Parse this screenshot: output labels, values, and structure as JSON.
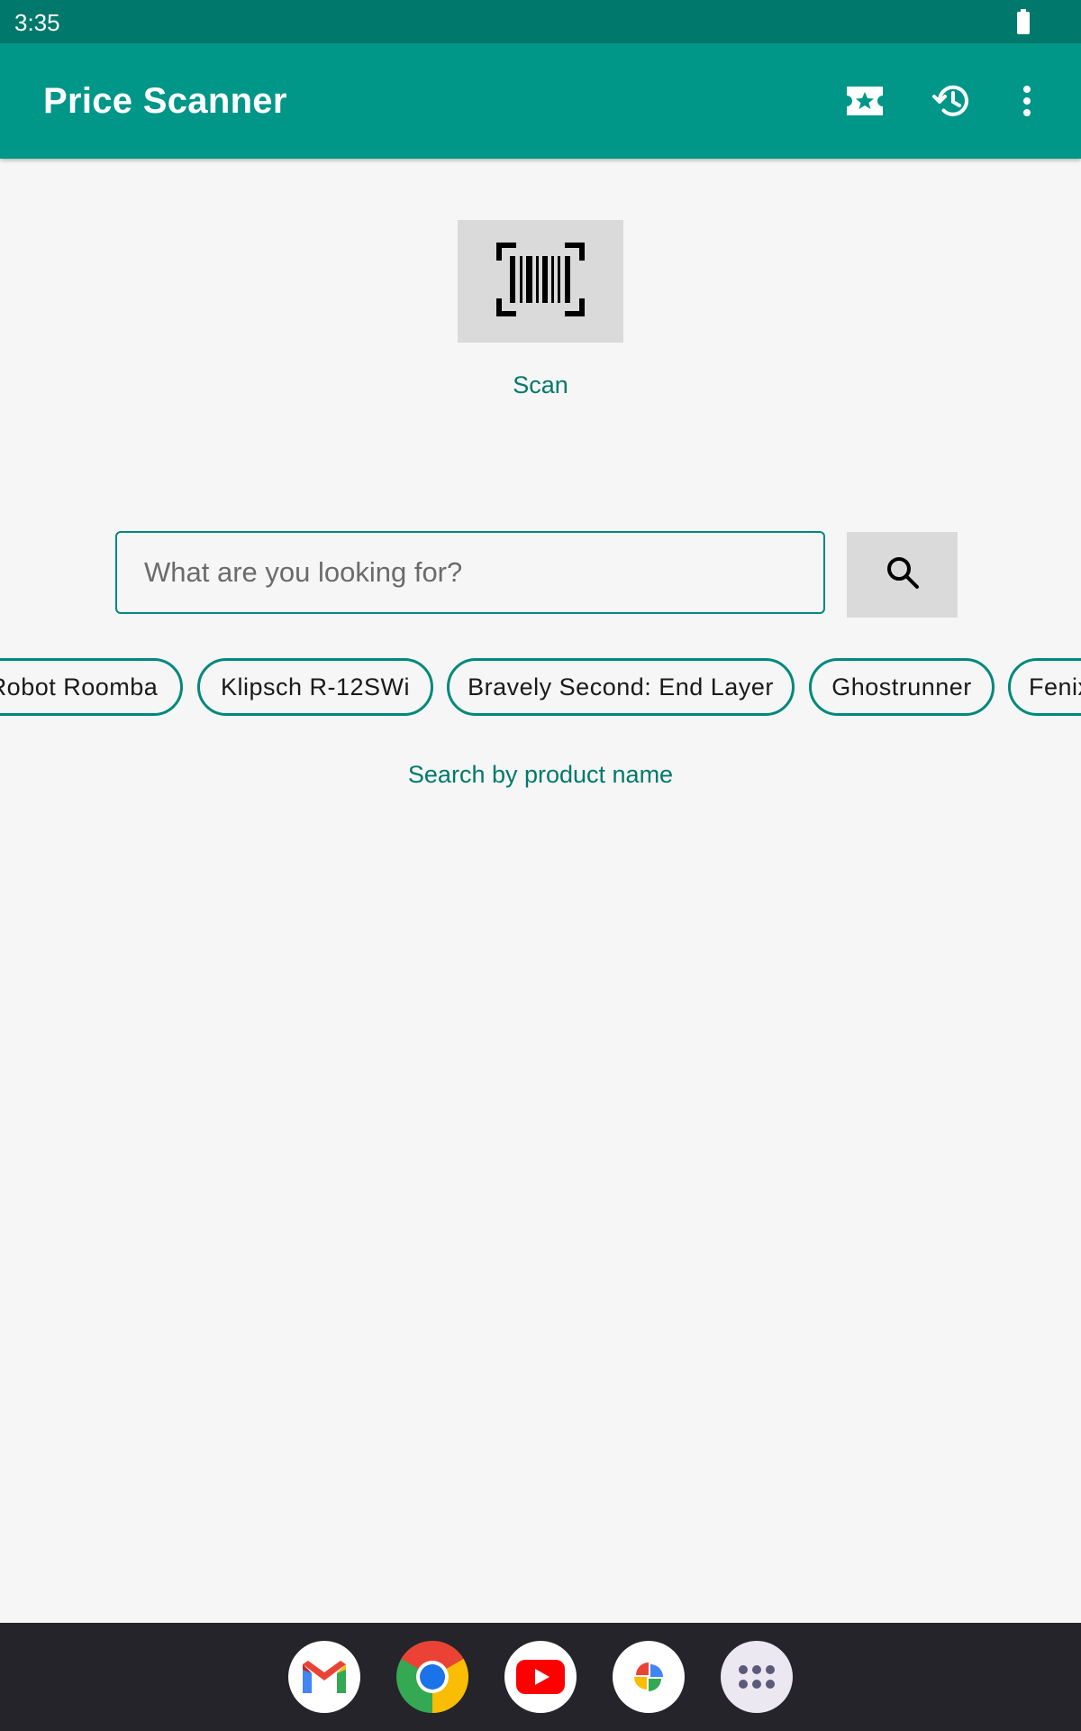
{
  "status_bar": {
    "time": "3:35",
    "battery_icon": "battery-full-icon"
  },
  "app_bar": {
    "title": "Price Scanner",
    "actions": [
      "ticket-star-icon",
      "history-icon",
      "more-vert-icon"
    ]
  },
  "scan": {
    "icon": "barcode-scan-icon",
    "label": "Scan"
  },
  "search": {
    "placeholder": "What are you looking for?",
    "value": "",
    "button_icon": "search-icon",
    "hint": "Search by product name"
  },
  "chips": [
    "Robot Roomba",
    "Klipsch R-12SWi",
    "Bravely Second: End Layer",
    "Ghostrunner",
    "Fenix"
  ],
  "dock": [
    "gmail-icon",
    "chrome-icon",
    "youtube-icon",
    "photos-icon",
    "app-drawer-icon"
  ],
  "colors": {
    "primary": "#009688",
    "primary_dark": "#00786b",
    "accent_text": "#00796b",
    "nav_bar": "#25242a"
  }
}
